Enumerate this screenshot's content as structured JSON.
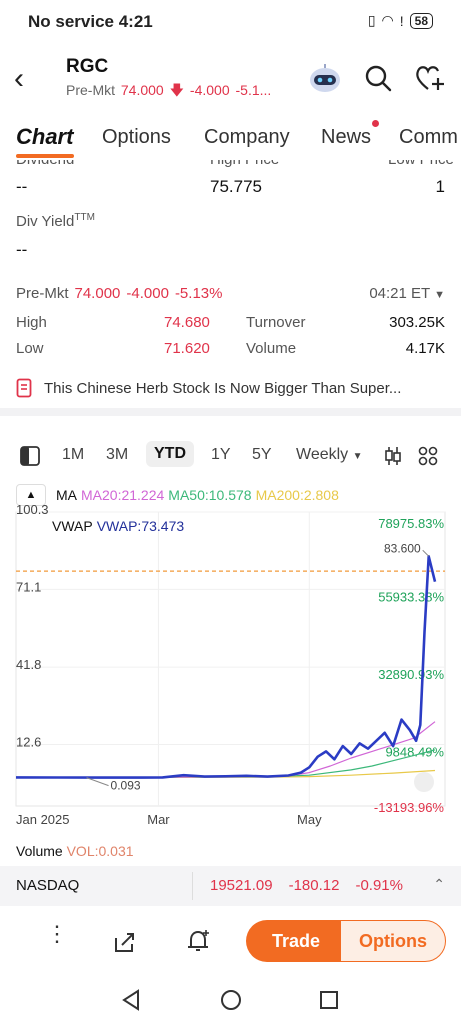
{
  "status_bar": {
    "carrier_time": "No service 4:21",
    "battery": "58"
  },
  "header": {
    "ticker": "RGC",
    "premkt_label": "Pre-Mkt",
    "premkt_price": "74.000",
    "premkt_change": "-4.000",
    "premkt_pct": "-5.1..."
  },
  "tabs": [
    {
      "label": "Chart"
    },
    {
      "label": "Options"
    },
    {
      "label": "Company"
    },
    {
      "label": "News"
    },
    {
      "label": "Comm"
    }
  ],
  "fundamentals": {
    "row1_labels": [
      "Dividend",
      "High Price",
      "Low Price"
    ],
    "row1_values": [
      "--",
      "75.775",
      "1"
    ],
    "div_yield_label": "Div Yield",
    "div_yield_sup": "TTM",
    "div_yield_value": "--"
  },
  "premarket": {
    "label": "Pre-Mkt",
    "price": "74.000",
    "change": "-4.000",
    "pct": "-5.13%",
    "time": "04:21 ET",
    "high_label": "High",
    "high": "74.680",
    "low_label": "Low",
    "low": "71.620",
    "turnover_label": "Turnover",
    "turnover": "303.25K",
    "volume_label": "Volume",
    "volume": "4.17K"
  },
  "news_ticker": "This Chinese Herb Stock Is Now Bigger Than Super...",
  "toolbar": {
    "ranges": [
      "1M",
      "3M",
      "YTD",
      "1Y",
      "5Y"
    ],
    "active_range": "YTD",
    "interval": "Weekly"
  },
  "indicators": {
    "ma_label": "MA",
    "ma20": "MA20:21.224",
    "ma50": "MA50:10.578",
    "ma200": "MA200:2.808",
    "vwap_label": "VWAP",
    "vwap": "VWAP:73.473",
    "colors": {
      "ma20": "#d166d6",
      "ma50": "#3cb87a",
      "ma200": "#e8c94a",
      "vwap": "#22309a",
      "price": "#2b3cc4"
    }
  },
  "chart_data": {
    "type": "line",
    "y_ticks": [
      "100.3",
      "71.1",
      "41.8",
      "12.6"
    ],
    "right_ticks": [
      "78975.83%",
      "55933.38%",
      "32890.93%",
      "9848.49%",
      "-13193.96%"
    ],
    "x_ticks": [
      "Jan 2025",
      "Mar",
      "May"
    ],
    "ylim": [
      -10.6,
      100.3
    ],
    "annotation_high": "83.600",
    "annotation_low": "0.093",
    "current_price_line": 78.0,
    "series": [
      {
        "key": "price",
        "x": [
          0,
          0.1,
          0.2,
          0.3,
          0.35,
          0.4,
          0.45,
          0.5,
          0.55,
          0.6,
          0.65,
          0.68,
          0.7,
          0.72,
          0.74,
          0.76,
          0.78,
          0.8,
          0.82,
          0.84,
          0.86,
          0.88,
          0.9,
          0.92,
          0.94,
          0.955,
          0.965,
          0.975,
          0.985,
          1.0
        ],
        "y": [
          0.2,
          0.15,
          0.1,
          0.1,
          0.2,
          1.0,
          0.5,
          0.6,
          0.8,
          0.5,
          0.9,
          2.0,
          4.0,
          8.0,
          10.0,
          7.0,
          12.0,
          9.0,
          13.0,
          11.0,
          14.0,
          17.0,
          12.0,
          22.0,
          18.0,
          14.0,
          20.0,
          55.0,
          83.6,
          74.0
        ]
      },
      {
        "key": "ma20",
        "x": [
          0,
          0.3,
          0.5,
          0.6,
          0.65,
          0.7,
          0.75,
          0.8,
          0.85,
          0.9,
          0.95,
          1.0
        ],
        "y": [
          0.2,
          0.2,
          0.5,
          0.6,
          0.8,
          2.0,
          4.5,
          7.5,
          10.0,
          12.5,
          15.0,
          21.2
        ]
      },
      {
        "key": "ma50",
        "x": [
          0,
          0.3,
          0.5,
          0.6,
          0.7,
          0.8,
          0.85,
          0.9,
          0.95,
          1.0
        ],
        "y": [
          0.2,
          0.2,
          0.4,
          0.5,
          1.0,
          3.0,
          4.5,
          6.5,
          8.5,
          10.6
        ]
      },
      {
        "key": "ma200",
        "x": [
          0,
          0.3,
          0.6,
          0.7,
          0.8,
          0.9,
          1.0
        ],
        "y": [
          0.2,
          0.2,
          0.3,
          0.5,
          1.0,
          1.8,
          2.8
        ]
      }
    ]
  },
  "volume_row": {
    "label": "Volume",
    "value": "VOL:0.031"
  },
  "nasdaq": {
    "name": "NASDAQ",
    "price": "19521.09",
    "change": "-180.12",
    "pct": "-0.91%"
  },
  "bottom": {
    "trade": "Trade",
    "options": "Options"
  }
}
